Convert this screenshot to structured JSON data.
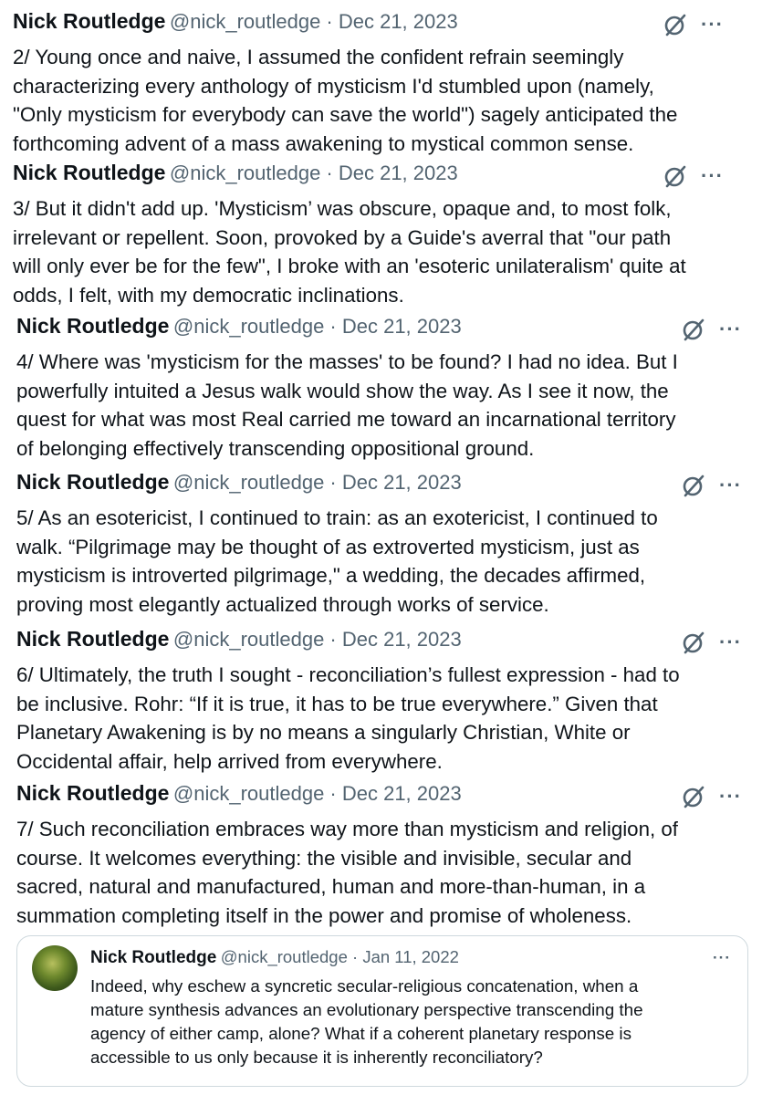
{
  "tweets": [
    {
      "name": "Nick Routledge",
      "meta": "@nick_routledge · Dec 21, 2023",
      "text": "2/ Young once and naive, I assumed the confident refrain seemingly\ncharacterizing every anthology of mysticism I'd stumbled upon (namely,\n\"Only mysticism for everybody can save the world\") sagely anticipated the\nforthcoming advent of a mass awakening to mystical common sense.",
      "more": "···",
      "icon": "grok-icon"
    },
    {
      "name": "Nick Routledge",
      "meta": "@nick_routledge · Dec 21, 2023",
      "text": "3/ But it didn't add up. 'Mysticism’ was obscure, opaque and, to most folk,\nirrelevant or repellent. Soon, provoked by a Guide's averral that \"our path\nwill only ever be for the few\", I broke with an 'esoteric unilateralism' quite at\nodds, I felt, with my democratic inclinations.",
      "more": "···",
      "icon": "grok-icon"
    },
    {
      "name": "Nick Routledge",
      "meta": "@nick_routledge · Dec 21, 2023",
      "text": "4/ Where was 'mysticism for the masses' to be found? I had no idea. But I\npowerfully intuited a Jesus walk would show the way. As I see it now, the\nquest for what was most Real carried me toward an incarnational territory\nof belonging effectively transcending oppositional ground.",
      "more": "···",
      "icon": "grok-icon"
    },
    {
      "name": "Nick Routledge",
      "meta": "@nick_routledge · Dec 21, 2023",
      "text": "5/ As an esotericist, I continued to train: as an exotericist, I continued to\nwalk. “Pilgrimage may be thought of as extroverted mysticism, just as\nmysticism is introverted pilgrimage,\" a wedding, the decades affirmed,\nproving most elegantly actualized through works of service.",
      "more": "···",
      "icon": "grok-icon"
    },
    {
      "name": "Nick Routledge",
      "meta": "@nick_routledge · Dec 21, 2023",
      "text": "6/ Ultimately, the truth I sought - reconciliation’s fullest expression - had to\nbe inclusive. Rohr: “If it is true, it has to be true everywhere.” Given that\nPlanetary Awakening is by no means a singularly Christian, White or\nOccidental affair, help arrived from everywhere.",
      "more": "···",
      "icon": "grok-icon"
    },
    {
      "name": "Nick Routledge",
      "meta": "@nick_routledge · Dec 21, 2023",
      "text": "7/ Such reconciliation embraces way more than mysticism and religion, of\ncourse. It welcomes everything: the visible and invisible, secular and\nsacred, natural and manufactured, human and more-than-human, in a\nsummation completing itself in the power and promise of wholeness.",
      "more": "···",
      "icon": "grok-icon"
    }
  ],
  "quote": {
    "name": "Nick Routledge",
    "meta": "@nick_routledge · Jan 11, 2022",
    "more": "···",
    "text": "Indeed, why eschew a syncretic secular-religious concatenation, when a\nmature synthesis advances an evolutionary perspective transcending the\nagency of either camp, alone? What if a coherent planetary response is\naccessible to us only because it is inherently reconciliatory?"
  },
  "colors": {
    "text": "#0f1419",
    "muted": "#536471",
    "border": "#cfd9de"
  }
}
